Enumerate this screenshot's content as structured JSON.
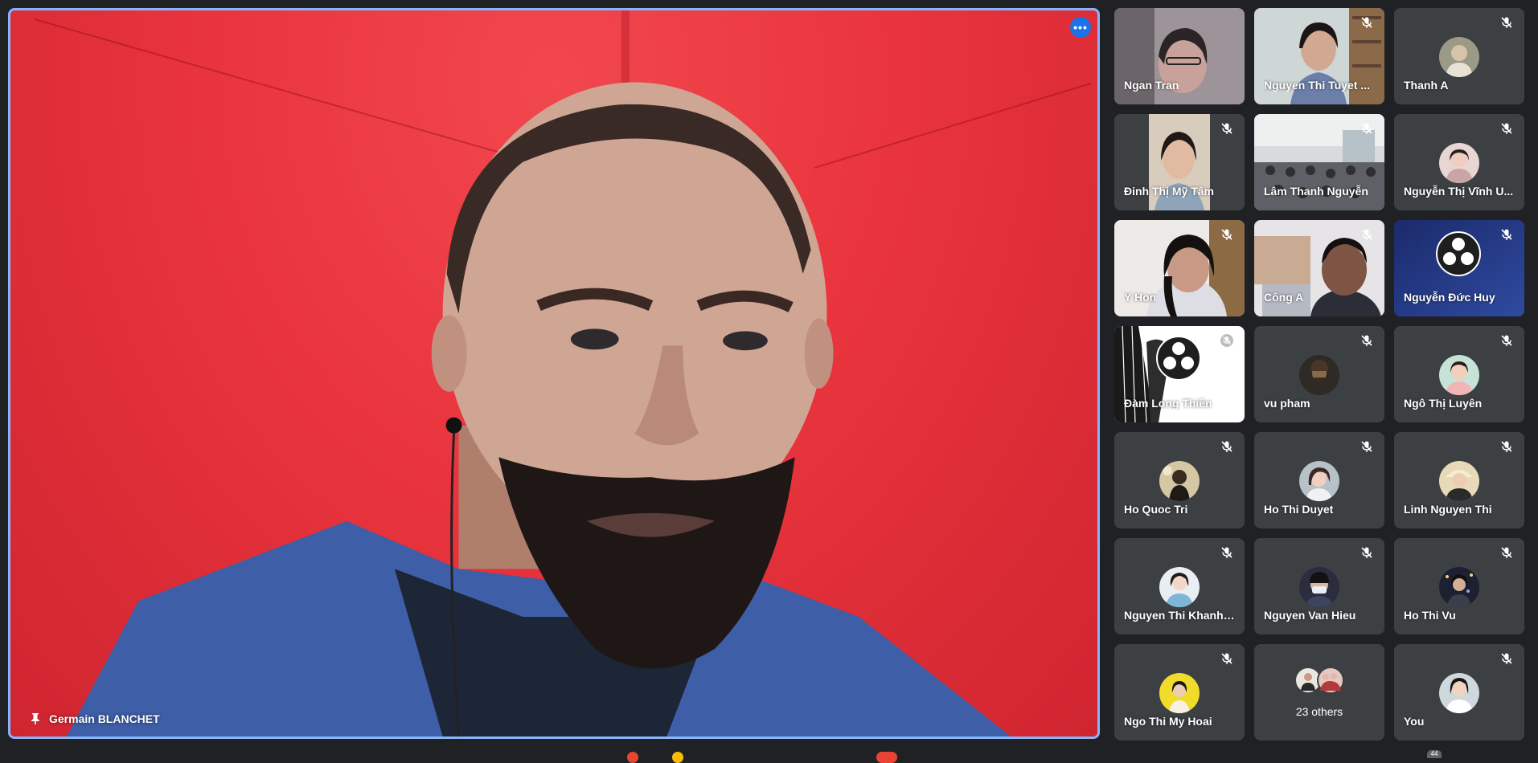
{
  "main": {
    "speaker_name": "Germain BLANCHET",
    "more_options_label": "•••"
  },
  "tiles": [
    {
      "name": "Ngan Tran",
      "kind": "video",
      "muted": false
    },
    {
      "name": "Nguyen Thi Tuyet ...",
      "kind": "video",
      "muted": true
    },
    {
      "name": "Thanh A",
      "kind": "avatar",
      "muted": true
    },
    {
      "name": "Đinh Thị Mỹ Tâm",
      "kind": "video",
      "muted": true
    },
    {
      "name": "Lâm Thanh Nguyễn",
      "kind": "video",
      "muted": true
    },
    {
      "name": "Nguyễn Thị Vĩnh U...",
      "kind": "avatar",
      "muted": true
    },
    {
      "name": "Y Hon",
      "kind": "video",
      "muted": true
    },
    {
      "name": "Công A",
      "kind": "video",
      "muted": true
    },
    {
      "name": "Nguyễn Đức Huy",
      "kind": "video",
      "muted": true
    },
    {
      "name": "Đàm Long Thiên",
      "kind": "video",
      "muted": true
    },
    {
      "name": "vu pham",
      "kind": "avatar",
      "muted": true
    },
    {
      "name": "Ngô Thị Luyên",
      "kind": "avatar",
      "muted": true
    },
    {
      "name": "Ho Quoc Tri",
      "kind": "avatar",
      "muted": true
    },
    {
      "name": "Ho Thi Duyet",
      "kind": "avatar",
      "muted": true
    },
    {
      "name": "Linh Nguyen Thi",
      "kind": "avatar",
      "muted": true
    },
    {
      "name": "Nguyen Thi Khanh ...",
      "kind": "avatar",
      "muted": true
    },
    {
      "name": "Nguyen Van Hieu",
      "kind": "avatar",
      "muted": true
    },
    {
      "name": "Ho Thi Vu",
      "kind": "avatar",
      "muted": true
    },
    {
      "name": "Ngo Thi My Hoai",
      "kind": "avatar",
      "muted": true
    },
    {
      "name": "23 others",
      "kind": "others",
      "muted": false
    },
    {
      "name": "You",
      "kind": "avatar",
      "muted": true
    }
  ],
  "bottom": {
    "participant_count": "44"
  },
  "colors": {
    "accent": "#8ab4f8",
    "tile_bg": "#3c4043",
    "page_bg": "#202124",
    "more_button": "#1a73e8"
  }
}
